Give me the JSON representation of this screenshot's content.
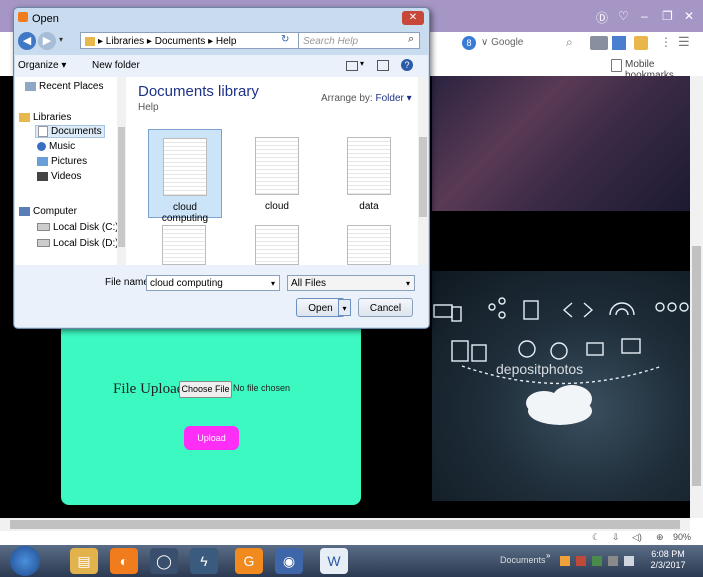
{
  "browser": {
    "window_controls": [
      "Ⓓ",
      "♡",
      "–",
      "❐",
      "✕"
    ],
    "search_engine": "Google",
    "bookmarks_label": "Mobile bookmarks",
    "zoom": "90%"
  },
  "page": {
    "upload_label": "File Upload:",
    "choose_file": "Choose File",
    "no_file": "No file chosen",
    "upload_button": "Upload",
    "image_watermark": "depositphotos"
  },
  "dialog": {
    "title": "Open",
    "breadcrumb": "▸ Libraries ▸ Documents ▸ Help",
    "search_placeholder": "Search Help",
    "organize": "Organize ▾",
    "new_folder": "New folder",
    "nav": [
      "Recent Places",
      "Libraries",
      "Documents",
      "Music",
      "Pictures",
      "Videos",
      "Computer",
      "Local Disk (C:)",
      "Local Disk (D:)"
    ],
    "library_title": "Documents library",
    "library_sub": "Help",
    "arrange_by": "Arrange by:",
    "arrange_value": "Folder ▾",
    "files": [
      "cloud computing",
      "cloud",
      "data"
    ],
    "filename_label": "File name:",
    "filename_value": "cloud computing",
    "filter": "All Files",
    "open_button": "Open",
    "cancel_button": "Cancel"
  },
  "taskbar": {
    "documents": "Documents",
    "time": "6:08 PM",
    "date": "2/3/2017"
  }
}
